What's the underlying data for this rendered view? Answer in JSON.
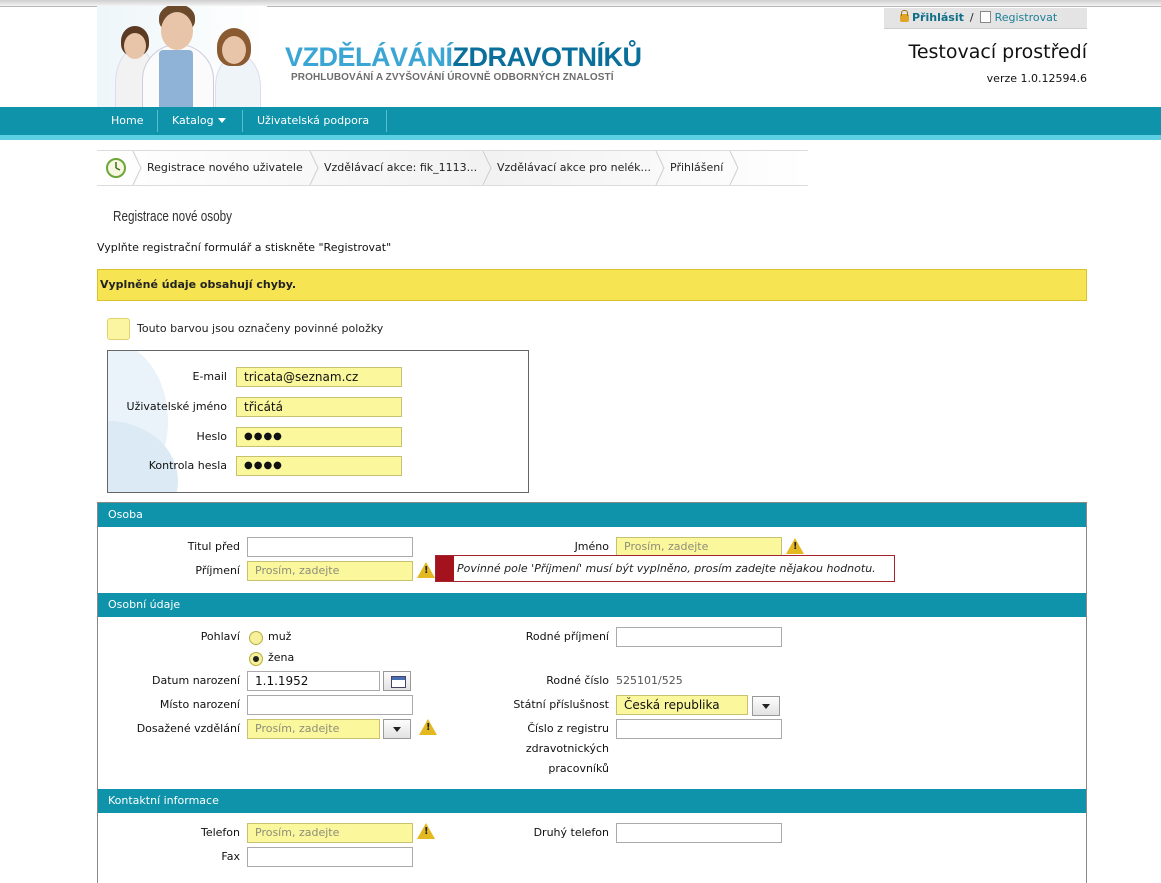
{
  "header": {
    "logo_part1": "VZDĚLÁVÁNÍ",
    "logo_part2": "ZDRAVOTNÍKŮ",
    "logo_subtitle": "PROHLUBOVÁNÍ A ZVYŠOVÁNÍ ÚROVNĚ ODBORNÝCH ZNALOSTÍ",
    "login_label": "Přihlásit",
    "login_separator": "/",
    "register_label": "Registrovat",
    "environment": "Testovací prostředí",
    "version": "verze 1.0.12594.6"
  },
  "nav": {
    "home": "Home",
    "catalog": "Katalog",
    "support": "Uživatelská podpora"
  },
  "breadcrumb": [
    "Registrace nového uživatele",
    "Vzdělávací akce: fik_1113...",
    "Vzdělávací akce pro nelék...",
    "Přihlášení"
  ],
  "page": {
    "title": "Registrace nové osoby",
    "intro": "Vyplňte registrační formulář a stiskněte \"Registrovat\"",
    "error_banner": "Vyplněné údaje obsahují chyby.",
    "required_legend": "Touto barvou jsou označeny povinné položky"
  },
  "credentials": {
    "email_label": "E-mail",
    "email_value": "tricata@seznam.cz",
    "username_label": "Uživatelské jméno",
    "username_value": "třicátá",
    "password_label": "Heslo",
    "password_value": "●●●●",
    "password_confirm_label": "Kontrola hesla",
    "password_confirm_value": "●●●●"
  },
  "person": {
    "section_title": "Osoba",
    "title_before_label": "Titul před",
    "title_before_value": "",
    "first_name_label": "Jméno",
    "first_name_placeholder": "Prosím, zadejte",
    "last_name_label": "Příjmení",
    "last_name_placeholder": "Prosím, zadejte",
    "warning_glyph": "!",
    "error_tooltip": "Povinné pole 'Příjmení' musí být vyplněno, prosím zadejte nějakou hodnotu."
  },
  "personal": {
    "section_title": "Osobní údaje",
    "gender_label": "Pohlaví",
    "gender_male": "muž",
    "gender_female": "žena",
    "gender_selected": "žena",
    "birth_date_label": "Datum narození",
    "birth_date_value": "1.1.1952",
    "birth_place_label": "Místo narození",
    "birth_place_value": "",
    "education_label": "Dosažené vzdělání",
    "education_placeholder": "Prosím, zadejte",
    "maiden_name_label": "Rodné příjmení",
    "maiden_name_value": "",
    "birth_number_label": "Rodné číslo",
    "birth_number_value": "525101/525",
    "citizenship_label": "Státní příslušnost",
    "citizenship_value": "Česká republika",
    "registry_label_1": "Číslo z registru",
    "registry_label_2": "zdravotnických",
    "registry_label_3": "pracovníků",
    "registry_value": ""
  },
  "contact": {
    "section_title": "Kontaktní informace",
    "phone_label": "Telefon",
    "phone_placeholder": "Prosím, zadejte",
    "second_phone_label": "Druhý telefon",
    "second_phone_value": "",
    "fax_label": "Fax",
    "fax_value": ""
  },
  "colors": {
    "nav": "#0e93aa",
    "required_field": "#fbf79c",
    "error_banner": "#f6e452",
    "error_marker": "#a3121d"
  },
  "icons": [
    "lock-icon",
    "edit-icon",
    "clock-icon",
    "calendar-icon",
    "dropdown-arrow-icon",
    "warning-icon"
  ]
}
